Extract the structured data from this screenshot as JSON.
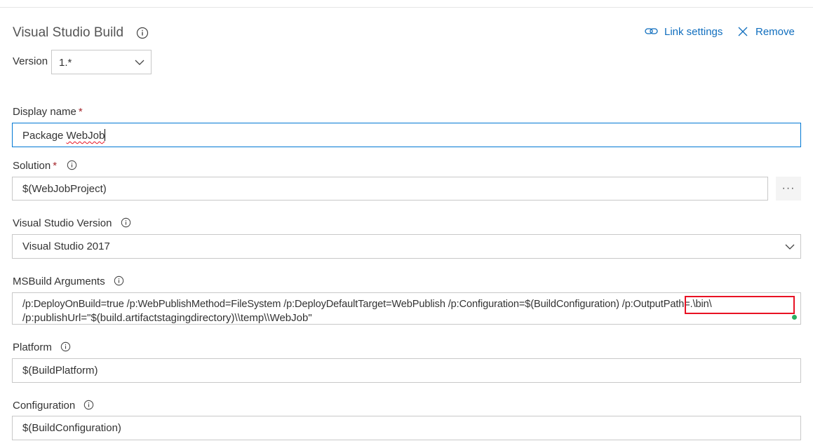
{
  "header": {
    "title": "Visual Studio Build",
    "link_settings": "Link settings",
    "remove": "Remove"
  },
  "version": {
    "label": "Version",
    "value": "1.*"
  },
  "display_name": {
    "label": "Display name",
    "required": "*",
    "value_prefix": "Package ",
    "value_misspelled": "WebJob"
  },
  "solution": {
    "label": "Solution",
    "required": "*",
    "value": "$(WebJobProject)",
    "browse_label": "···"
  },
  "vs_version": {
    "label": "Visual Studio Version",
    "value": "Visual Studio 2017"
  },
  "msbuild": {
    "label": "MSBuild Arguments",
    "line1": "/p:DeployOnBuild=true /p:WebPublishMethod=FileSystem /p:DeployDefaultTarget=WebPublish /p:Configuration=$(BuildConfiguration) /p:OutputPath=.\\bin\\",
    "line2": "/p:publishUrl=\"$(build.artifactstagingdirectory)\\\\temp\\\\WebJob\""
  },
  "platform": {
    "label": "Platform",
    "value": "$(BuildPlatform)"
  },
  "configuration": {
    "label": "Configuration",
    "value": "$(BuildConfiguration)"
  },
  "colors": {
    "link": "#106ebe",
    "focus": "#0078d4",
    "required": "#a4262c",
    "highlight": "#e81123",
    "status_dot": "#27ae60"
  }
}
